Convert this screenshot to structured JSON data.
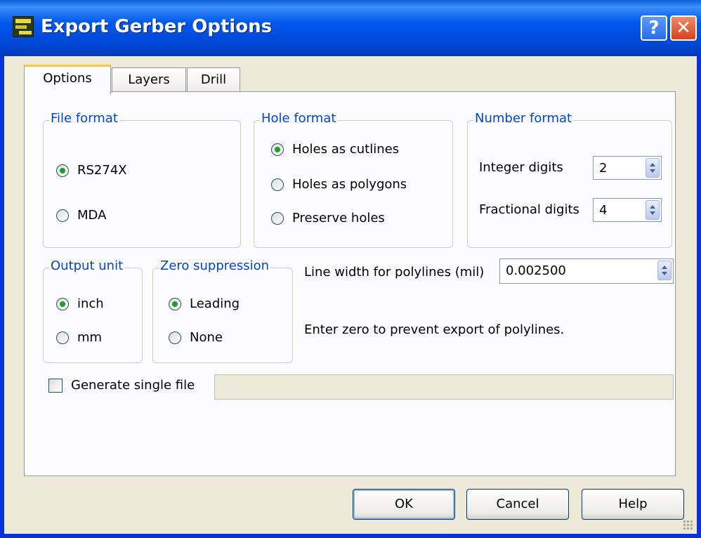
{
  "window": {
    "title": "Export Gerber Options",
    "help_label": "?",
    "close_label": "✕"
  },
  "tabs": [
    {
      "label": "Options",
      "active": true
    },
    {
      "label": "Layers",
      "active": false
    },
    {
      "label": "Drill",
      "active": false
    }
  ],
  "file_format": {
    "legend": "File format",
    "options": [
      {
        "label": "RS274X",
        "checked": true
      },
      {
        "label": "MDA",
        "checked": false
      }
    ]
  },
  "hole_format": {
    "legend": "Hole format",
    "options": [
      {
        "label": "Holes as cutlines",
        "checked": true
      },
      {
        "label": "Holes as polygons",
        "checked": false
      },
      {
        "label": "Preserve holes",
        "checked": false
      }
    ]
  },
  "number_format": {
    "legend": "Number format",
    "integer_label": "Integer digits",
    "integer_value": "2",
    "fractional_label": "Fractional digits",
    "fractional_value": "4"
  },
  "output_unit": {
    "legend": "Output unit",
    "options": [
      {
        "label": "inch",
        "checked": true
      },
      {
        "label": "mm",
        "checked": false
      }
    ]
  },
  "zero_suppression": {
    "legend": "Zero suppression",
    "options": [
      {
        "label": "Leading",
        "checked": true
      },
      {
        "label": "None",
        "checked": false
      }
    ]
  },
  "line_width": {
    "label": "Line width for polylines (mil)",
    "value": "0.002500",
    "hint": "Enter zero to prevent export of polylines."
  },
  "single_file": {
    "label": "Generate single file",
    "checked": false,
    "value": ""
  },
  "buttons": {
    "ok": "OK",
    "cancel": "Cancel",
    "help": "Help"
  },
  "colors": {
    "titlebar": "#0058ee",
    "legend_text": "#0046d5",
    "radio_dot": "#21a121",
    "active_tab_accent": "#ffc83c"
  }
}
